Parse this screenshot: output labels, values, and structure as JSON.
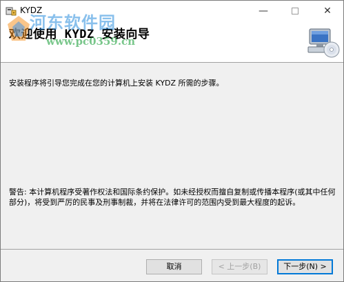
{
  "window": {
    "title": "KYDZ",
    "minimize_glyph": "—",
    "close_glyph": "✕"
  },
  "header": {
    "heading": "欢迎使用 KYDZ 安装向导",
    "icon": "computer-cd-icon"
  },
  "watermark": {
    "line1": "河东软件园",
    "line2": "www.pc0359.cn"
  },
  "main": {
    "intro": "安装程序将引导您完成在您的计算机上安装 KYDZ 所需的步骤。",
    "warning": "警告: 本计算机程序受著作权法和国际条约保护。如未经授权而擅自复制或传播本程序(或其中任何部分)，将受到严厉的民事及刑事制裁，并将在法律许可的范围内受到最大程度的起诉。"
  },
  "footer": {
    "cancel_label": "取消",
    "back_label": "< 上一步(B)",
    "next_label": "下一步(N) >"
  }
}
